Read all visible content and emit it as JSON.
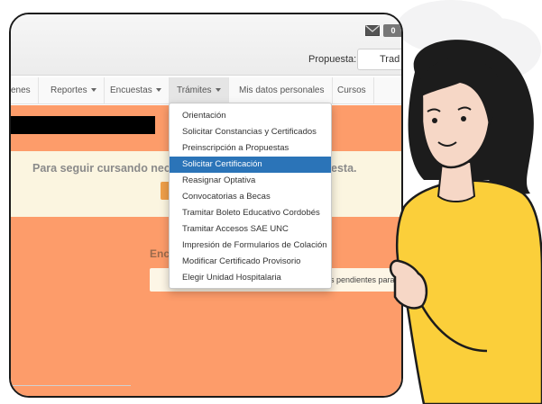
{
  "header": {
    "mail_badge": "0",
    "propuesta_label": "Propuesta:",
    "propuesta_value": "Trad"
  },
  "nav": {
    "items": [
      {
        "label": "enes",
        "caret": false
      },
      {
        "label": "Reportes",
        "caret": true
      },
      {
        "label": "Encuestas",
        "caret": true
      },
      {
        "label": "Trámites",
        "caret": true,
        "active": true
      },
      {
        "label": "Mis datos personales",
        "caret": false
      },
      {
        "label": "Cursos",
        "caret": false
      }
    ]
  },
  "alert": {
    "text_left": "Para seguir cursando nec",
    "text_right": "esta."
  },
  "encuestas": {
    "heading": "Enc",
    "box_text": "s pendientes para c"
  },
  "dropdown": {
    "items": [
      "Orientación",
      "Solicitar Constancias y Certificados",
      "Preinscripción a Propuestas",
      "Solicitar Certificación",
      "Reasignar Optativa",
      "Convocatorias a Becas",
      "Tramitar Boleto Educativo Cordobés",
      "Tramitar Accesos SAE UNC",
      "Impresión de Formularios de Colación",
      "Modificar Certificado Provisorio",
      "Elegir Unidad Hospitalaria"
    ],
    "highlighted_index": 3
  },
  "colors": {
    "content_bg": "#fd9c6a",
    "alert_bg": "#fbf5e0",
    "highlight": "#2b74b8",
    "hair": "#1c1c1c",
    "skin": "#f6d7c6",
    "shirt": "#fbcf3a"
  }
}
